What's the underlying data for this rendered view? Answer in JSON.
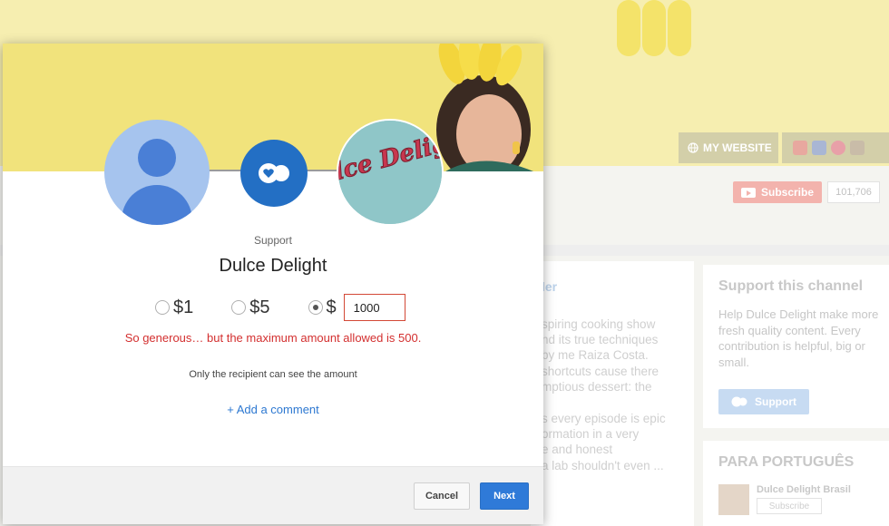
{
  "background": {
    "links": {
      "website_label": "MY WEBSITE"
    },
    "subscribe": {
      "label": "Subscribe",
      "count": "101,706"
    },
    "main": {
      "title_fragment": "ler",
      "description_lines": [
        "spiring cooking show",
        "nd its true techniques",
        "by me Raiza Costa.",
        "shortcuts cause there",
        "mptious dessert: the"
      ],
      "description_lines_2": [
        "s every episode is epic",
        "ormation in a very",
        "e and honest",
        "a lab shouldn't even ..."
      ]
    },
    "support_card": {
      "title": "Support this channel",
      "description": "Help Dulce Delight make more fresh quality content. Every contribution is helpful, big or small.",
      "button_label": "Support"
    },
    "portuguese_card": {
      "title": "PARA PORTUGUÊS",
      "channel_name": "Dulce Delight Brasil",
      "subscribe_label": "Subscribe"
    }
  },
  "modal": {
    "support_label": "Support",
    "channel_name": "Dulce Delight",
    "channel_logo_text": "Dulce Delight",
    "amount_options": [
      {
        "label": "$1",
        "selected": false
      },
      {
        "label": "$5",
        "selected": false
      },
      {
        "label": "$",
        "selected": true
      }
    ],
    "custom_amount_value": "1000",
    "error_message": "So generous… but the maximum amount allowed is 500.",
    "privacy_note": "Only the recipient can see the amount",
    "add_comment_label": "+ Add a comment",
    "cancel_label": "Cancel",
    "next_label": "Next"
  },
  "colors": {
    "accent_blue": "#2f7ad8",
    "error_red": "#d32f2f",
    "banner_yellow": "#f1e37c"
  },
  "icons": [
    "user-avatar-icon",
    "support-heart-logo-icon",
    "radio-icon",
    "globe-icon",
    "youtube-play-icon"
  ]
}
